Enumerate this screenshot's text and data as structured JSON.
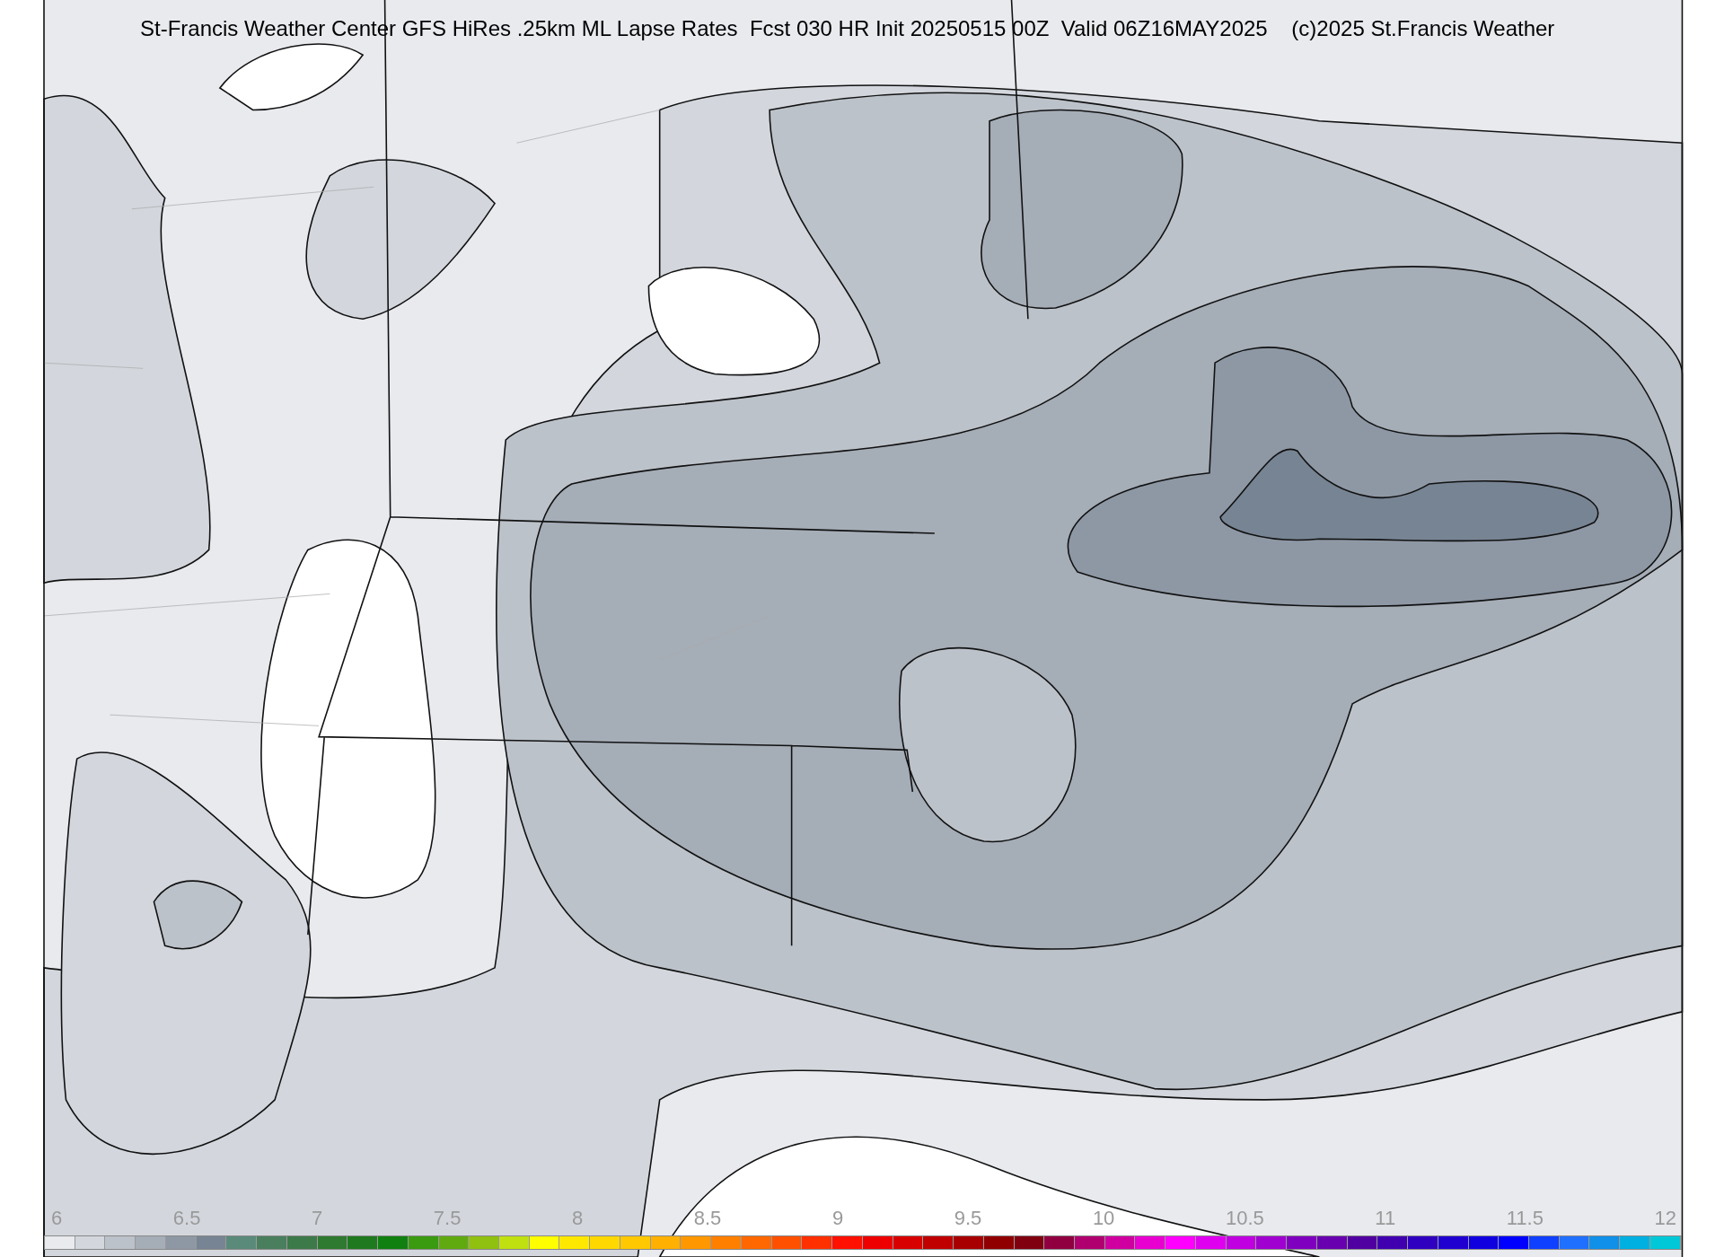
{
  "title": "St-Francis Weather Center GFS HiRes .25km ML Lapse Rates  Fcst 030 HR Init 20250515 00Z  Valid 06Z16MAY2025    (c)2025 St.Francis Weather",
  "colorbar": {
    "labels": [
      "6",
      "6.5",
      "7",
      "7.5",
      "8",
      "8.5",
      "9",
      "9.5",
      "10",
      "10.5",
      "11",
      "11.5",
      "12"
    ],
    "swatches": [
      {
        "color": "#e8eaee"
      },
      {
        "color": "#d3d7dd"
      },
      {
        "color": "#bcc2ca"
      },
      {
        "color": "#a5adb7"
      },
      {
        "color": "#8e98a5"
      },
      {
        "color": "#778493"
      },
      {
        "color": "#5a8a7a"
      },
      {
        "color": "#4a7f5e"
      },
      {
        "color": "#3d7a4a"
      },
      {
        "color": "#2e7a30"
      },
      {
        "color": "#1f7a1f"
      },
      {
        "color": "#108010"
      },
      {
        "color": "#3a9a10"
      },
      {
        "color": "#60aa10"
      },
      {
        "color": "#90c010"
      },
      {
        "color": "#c0e010"
      },
      {
        "color": "#ffff00"
      },
      {
        "color": "#ffe800"
      },
      {
        "color": "#ffd800"
      },
      {
        "color": "#ffc800"
      },
      {
        "color": "#ffb000"
      },
      {
        "color": "#ff9800"
      },
      {
        "color": "#ff8000"
      },
      {
        "color": "#ff6800"
      },
      {
        "color": "#ff5000"
      },
      {
        "color": "#ff3000"
      },
      {
        "color": "#ff1000"
      },
      {
        "color": "#ee0000"
      },
      {
        "color": "#d80000"
      },
      {
        "color": "#c00000"
      },
      {
        "color": "#a80000"
      },
      {
        "color": "#900000"
      },
      {
        "color": "#800010"
      },
      {
        "color": "#900040"
      },
      {
        "color": "#b00070"
      },
      {
        "color": "#d000a0"
      },
      {
        "color": "#e800d0"
      },
      {
        "color": "#ff00ff"
      },
      {
        "color": "#e000f0"
      },
      {
        "color": "#c000e0"
      },
      {
        "color": "#a000d0"
      },
      {
        "color": "#8000c0"
      },
      {
        "color": "#6800b0"
      },
      {
        "color": "#5000a0"
      },
      {
        "color": "#4000b0"
      },
      {
        "color": "#3000c0"
      },
      {
        "color": "#2000d0"
      },
      {
        "color": "#1000e0"
      },
      {
        "color": "#0000ff"
      },
      {
        "color": "#1040ff"
      },
      {
        "color": "#2070ff"
      },
      {
        "color": "#1090e8"
      },
      {
        "color": "#00b0e0"
      },
      {
        "color": "#00c8d8"
      }
    ]
  }
}
